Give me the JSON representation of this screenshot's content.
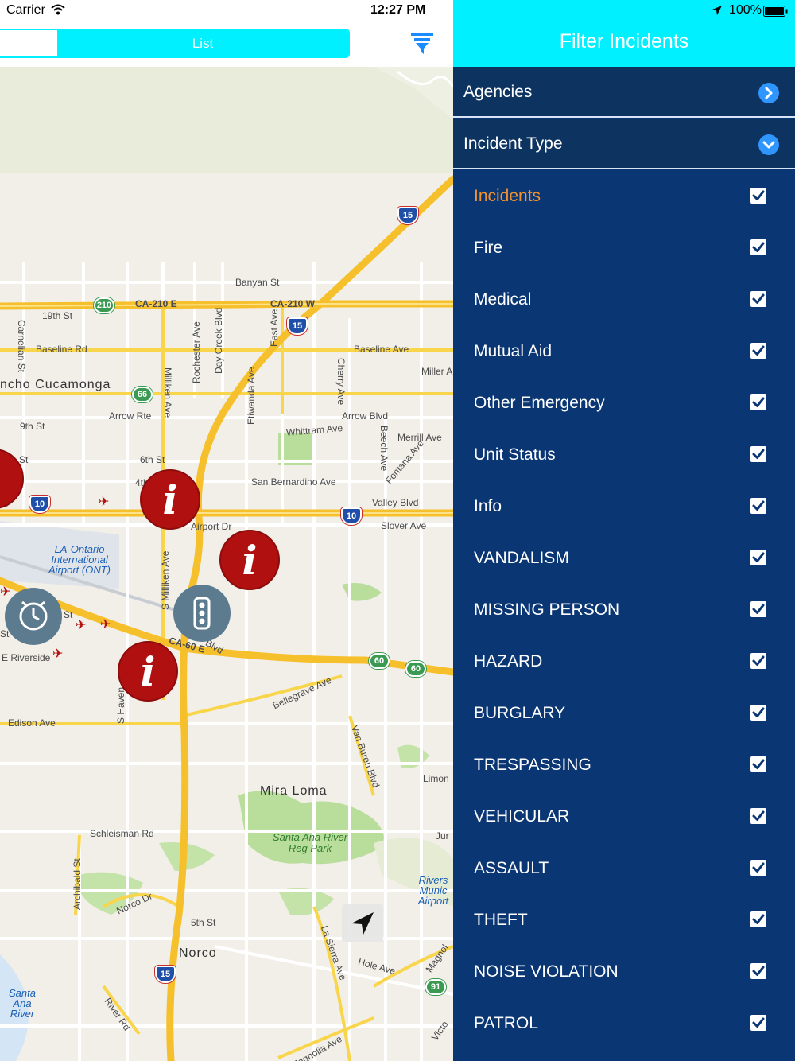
{
  "status_bar": {
    "carrier": "Carrier",
    "time": "12:27 PM",
    "battery": "100%"
  },
  "map_view": {
    "segmented_control": {
      "selected_segment": "",
      "list_label": "List"
    },
    "road_labels": [
      "Banyan St",
      "CA-210 E",
      "CA-210 W",
      "19th St",
      "Baseline Rd",
      "Baseline Ave",
      "Carnelian St",
      "Rochester Ave",
      "Day Creek Blvd",
      "Milliken Ave",
      "East Ave",
      "Etiwanda Ave",
      "Cherry Ave",
      "Miller A",
      "Arrow Rte",
      "Arrow Blvd",
      "Whittram Ave",
      "9th St",
      "6th St",
      "Merrill Ave",
      "Beech Ave",
      "Fontana Ave",
      "San Bernardino Ave",
      "Valley Blvd",
      "Slover Ave",
      "Airport Dr",
      "S Milliken Ave",
      "CA-60 E",
      "Blvd",
      "E Riverside",
      "Edison Ave",
      "S Haven",
      "Bellegrave Ave",
      "Van Buren Blvd",
      "Schleisman Rd",
      "Archibald St",
      "Norco Dr",
      "5th St",
      "La Sierra Ave",
      "Hole Ave",
      "River Rd",
      "Magnolia Ave",
      "Magnol",
      "Victo",
      "Jur",
      "Limon",
      "4th",
      "St",
      "St",
      "St"
    ],
    "city_labels": [
      "ncho Cucamonga",
      "Mira Loma",
      "Norco"
    ],
    "poi_labels": [
      "LA-Ontario International Airport (ONT)",
      "Santa Ana River Reg Park",
      "Rivers Munic Airport",
      "Santa Ana River"
    ],
    "route_shields": [
      "210",
      "15",
      "66",
      "10",
      "10",
      "60",
      "60",
      "15",
      "15",
      "91"
    ],
    "markers": {
      "info_icon": "info-icon",
      "clock_icon": "clock-icon",
      "traffic_light_icon": "traffic-light-icon",
      "helicopter_icon": "helicopter-icon"
    }
  },
  "filter_panel": {
    "title": "Filter Incidents",
    "sections": [
      {
        "label": "Agencies",
        "state": "collapsed",
        "icon": "chevron-right-icon"
      },
      {
        "label": "Incident Type",
        "state": "expanded",
        "icon": "chevron-down-icon"
      }
    ],
    "incident_types": [
      {
        "label": "Incidents",
        "checked": true,
        "color": "#f0922f"
      },
      {
        "label": "Fire",
        "checked": true
      },
      {
        "label": "Medical",
        "checked": true
      },
      {
        "label": "Mutual Aid",
        "checked": true
      },
      {
        "label": "Other Emergency",
        "checked": true
      },
      {
        "label": "Unit Status",
        "checked": true
      },
      {
        "label": "Info",
        "checked": true
      },
      {
        "label": "VANDALISM",
        "checked": true
      },
      {
        "label": "MISSING PERSON",
        "checked": true
      },
      {
        "label": "HAZARD",
        "checked": true
      },
      {
        "label": "BURGLARY",
        "checked": true
      },
      {
        "label": "TRESPASSING",
        "checked": true
      },
      {
        "label": "VEHICULAR",
        "checked": true
      },
      {
        "label": "ASSAULT",
        "checked": true
      },
      {
        "label": "THEFT",
        "checked": true
      },
      {
        "label": "NOISE VIOLATION",
        "checked": true
      },
      {
        "label": "PATROL",
        "checked": true
      }
    ]
  },
  "colors": {
    "accent_cyan": "#00f0ff",
    "panel_navy": "#0a3673",
    "section_navy": "#0d3361",
    "highlight_orange": "#f0922f",
    "marker_red": "#b01010",
    "chevron_blue": "#2f95ff"
  }
}
